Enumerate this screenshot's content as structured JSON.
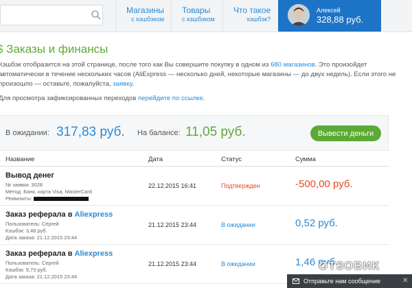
{
  "header": {
    "search": {
      "placeholder": ""
    },
    "nav": [
      {
        "title": "Магазины",
        "subtitle": "с кэшбэком"
      },
      {
        "title": "Товары",
        "subtitle": "с кэшбэком"
      },
      {
        "title": "Что такое",
        "subtitle": "кэшбэк?"
      }
    ],
    "user": {
      "name": "Алексей",
      "balance": "328,88 руб."
    }
  },
  "page": {
    "title": "$ Заказы и финансы",
    "info": {
      "line1_a": "Кэшбэк отобразится на этой странице, после того как Вы совершите покупку в одном из ",
      "line1_link": "680 магазинов",
      "line1_b": ". Это произойдет",
      "line2": "автоматически в течение нескольких часов (AliExpress — несколько дней, некоторые магазины — до двух недель). Если этого не",
      "line3_a": "произошло — оставьте, пожалуйста, ",
      "line3_link": "заявку",
      "line3_b": ".",
      "line4_a": "Для просмотра зафиксированных переходов ",
      "line4_link": "перейдите по ссылке",
      "line4_b": "."
    }
  },
  "balance": {
    "pending_label": "В ожидании:",
    "pending_value": "317,83 руб.",
    "available_label": "На балансе:",
    "available_value": "11,05 руб.",
    "withdraw_label": "Вывести деньги"
  },
  "table": {
    "headers": [
      "Название",
      "Дата",
      "Статус",
      "Сумма"
    ],
    "rows": [
      {
        "title": "Вывод денег",
        "title_link": "",
        "meta1": "№ заявки: 3028",
        "meta2": "Метод: Банк. карта Visa, MasterCard",
        "meta3": "Реквизиты:",
        "date": "22.12.2015 16:41",
        "status": "Подтвержден",
        "amount": "-500,00 руб."
      },
      {
        "title": "Заказ реферала в ",
        "title_link": "Aliexpress",
        "meta1": "Пользователь: Сергей",
        "meta2": "Кэшбэк: 3,48 руб.",
        "meta3": "Дата заказа: 21.12.2015 23:44",
        "date": "21.12.2015 23:44",
        "status": "В ожидании",
        "amount": "0,52 руб."
      },
      {
        "title": "Заказ реферала в ",
        "title_link": "Aliexpress",
        "meta1": "Пользователь: Сергей",
        "meta2": "Кэшбэк: 9,73 руб.",
        "meta3": "Дата заказа: 21.12.2015 23:44",
        "date": "21.12.2015 23:44",
        "status": "В ожидании",
        "amount": "1,46 руб."
      }
    ]
  },
  "chat": {
    "label": "Отправьте нам сообщение"
  },
  "watermark": "ОТЗОВИК",
  "colors": {
    "accent_blue": "#2a8ad6",
    "accent_green": "#5fa83c",
    "danger_red": "#e8491d",
    "user_box": "#1d74c7"
  }
}
